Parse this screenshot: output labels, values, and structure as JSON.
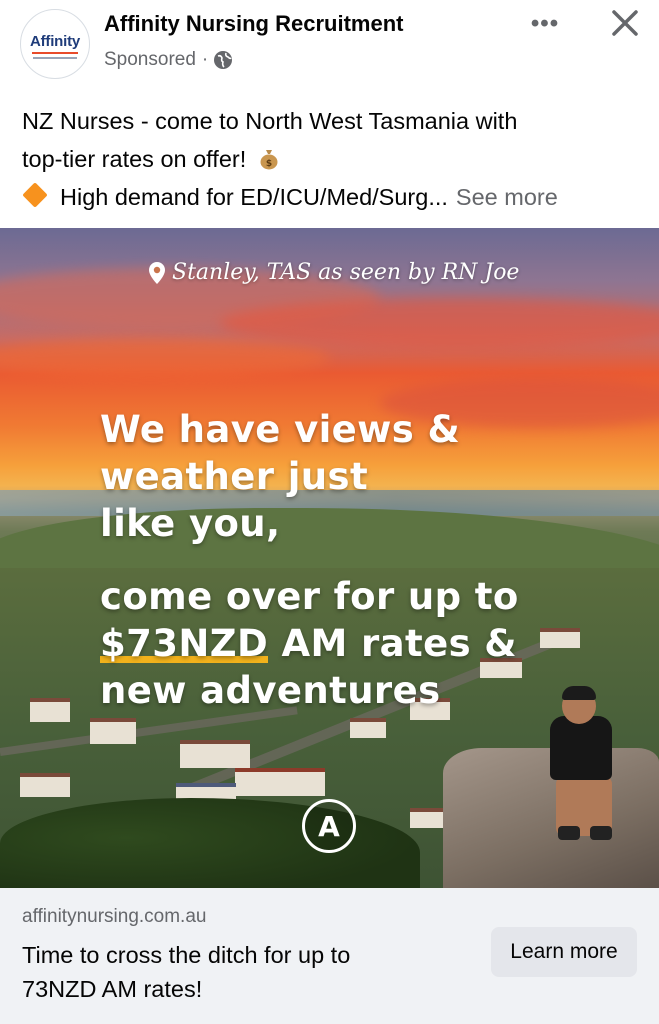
{
  "header": {
    "page_name": "Affinity Nursing Recruitment",
    "sponsored_label": "Sponsored",
    "separator": "·",
    "avatar_text": "Affinity",
    "more_icon": "more-dots-icon",
    "close_icon": "close-icon",
    "privacy_icon": "globe-icon"
  },
  "post": {
    "line1": "NZ Nurses - come to North West Tasmania with",
    "line2": "top-tier rates on offer!",
    "line3": "High demand for ED/ICU/Med/Surg...",
    "see_more": "See more",
    "emoji_icon": "money-bag-icon",
    "bullet_icon": "orange-diamond-icon"
  },
  "ad_image": {
    "location": "Stanley, TAS as seen by RN Joe",
    "headline": [
      "We have views &",
      "weather just",
      "like you,"
    ],
    "offer": [
      "come over for up to",
      "$73NZD",
      " AM rates &",
      "new adventures"
    ],
    "logo_letter": "A",
    "highlight_color": "#f2b21c"
  },
  "cta": {
    "domain": "affinitynursing.com.au",
    "title_line1": "Time to cross the ditch for up to",
    "title_line2": "73NZD AM rates!",
    "button_label": "Learn more"
  },
  "colors": {
    "secondary_text": "#65676b",
    "cta_background": "#f0f2f5",
    "button_background": "#e4e6eb"
  }
}
